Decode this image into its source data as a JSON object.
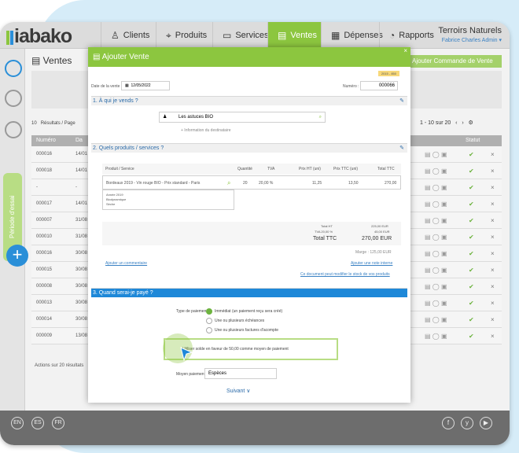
{
  "app": {
    "logo": "iabako",
    "nav": [
      {
        "label": "Clients",
        "icon": "person-icon"
      },
      {
        "label": "Produits",
        "icon": "tag-icon"
      },
      {
        "label": "Services",
        "icon": "briefcase-icon"
      },
      {
        "label": "Ventes",
        "icon": "receipt-icon"
      },
      {
        "label": "Dépenses",
        "icon": "invoice-icon"
      },
      {
        "label": "Rapports",
        "icon": "chart-icon"
      }
    ],
    "active_nav": "Ventes",
    "company": "Terroirs Naturels",
    "user": "Fabrice Charles Admin"
  },
  "page": {
    "title": "Ventes",
    "add_order_button": "Ajouter Commande de Vente",
    "periods_tab": "Période d'essai",
    "results_per_page": "10",
    "results_label": "Résultats / Page",
    "pagination": "1 - 10 sur 20",
    "columns": [
      "Numéro",
      "Da",
      "Statut"
    ],
    "rows": [
      {
        "num": "000016",
        "date": "14/01"
      },
      {
        "num": "000018",
        "date": "14/01"
      },
      {
        "num": "-",
        "date": "-"
      },
      {
        "num": "000017",
        "date": "14/01"
      },
      {
        "num": "000007",
        "date": "31/08"
      },
      {
        "num": "000010",
        "date": "31/08"
      },
      {
        "num": "000016",
        "date": "30/08"
      },
      {
        "num": "000015",
        "date": "30/08"
      },
      {
        "num": "000008",
        "date": "30/08"
      },
      {
        "num": "000013",
        "date": "30/08"
      },
      {
        "num": "000014",
        "date": "30/08"
      },
      {
        "num": "000009",
        "date": "13/08"
      }
    ],
    "bulk_actions": "Actions sur 20 résultats"
  },
  "modal": {
    "title": "Ajouter Vente",
    "close": "×",
    "badge": "2015 - 850",
    "date_label": "Date de la vente :",
    "date_value": "12/05/2022",
    "number_label": "Numéro :",
    "number_value": "000066",
    "section1": "1. À qui je vends ?",
    "client_value": "Les astuces BIO",
    "client_info": "+ Information du destinataire",
    "section2": "2. Quels produits / services ?",
    "table_headers": [
      "Produit / Service",
      "Quantité",
      "TVA",
      "Prix HT (uni)",
      "Prix TTC (uni)",
      "Total TTC"
    ],
    "product_name": "Bordeaux 2019 - Vin rouge BIO - Prix standard - Paris",
    "qty": "20",
    "tva": "20,00 %",
    "price_ht": "11,25",
    "price_ttc": "13,50",
    "total_ttc": "270,00",
    "product_details": [
      "Année 2019",
      "Biodynamique",
      "Sèche"
    ],
    "total_ht_label": "Total HT",
    "total_ht_value": "225,00 EUR",
    "tva_label": "TVA 20,00 %",
    "tva_value": "45,00 EUR",
    "total_ttc_label": "Total TTC",
    "total_ttc_value": "270,00 EUR",
    "marge": "Marge : 125,00 EUR",
    "add_comment": "Ajouter un commentaire",
    "add_note": "Ajouter une note interne",
    "stock_link": "Ce document peut modifier le stock de vos produits",
    "section3": "3. Quand serai-je payé ?",
    "payment_type_label": "Type de paiement :",
    "payment_options": [
      "Immédiat (un paiement reçu sera créé)",
      "Une ou plusieurs échéances",
      "Une ou plusieurs factures d'acompte"
    ],
    "solde_option": "Utiliser solde en faveur de 50,00 comme moyen de paiement",
    "payment_method_label": "Moyen paiement :",
    "payment_method_value": "Espèces",
    "next_button": "Suivant ∨"
  },
  "footer": {
    "langs": [
      "EN",
      "ES",
      "FR"
    ],
    "social": [
      "f",
      "y",
      "▶"
    ]
  }
}
